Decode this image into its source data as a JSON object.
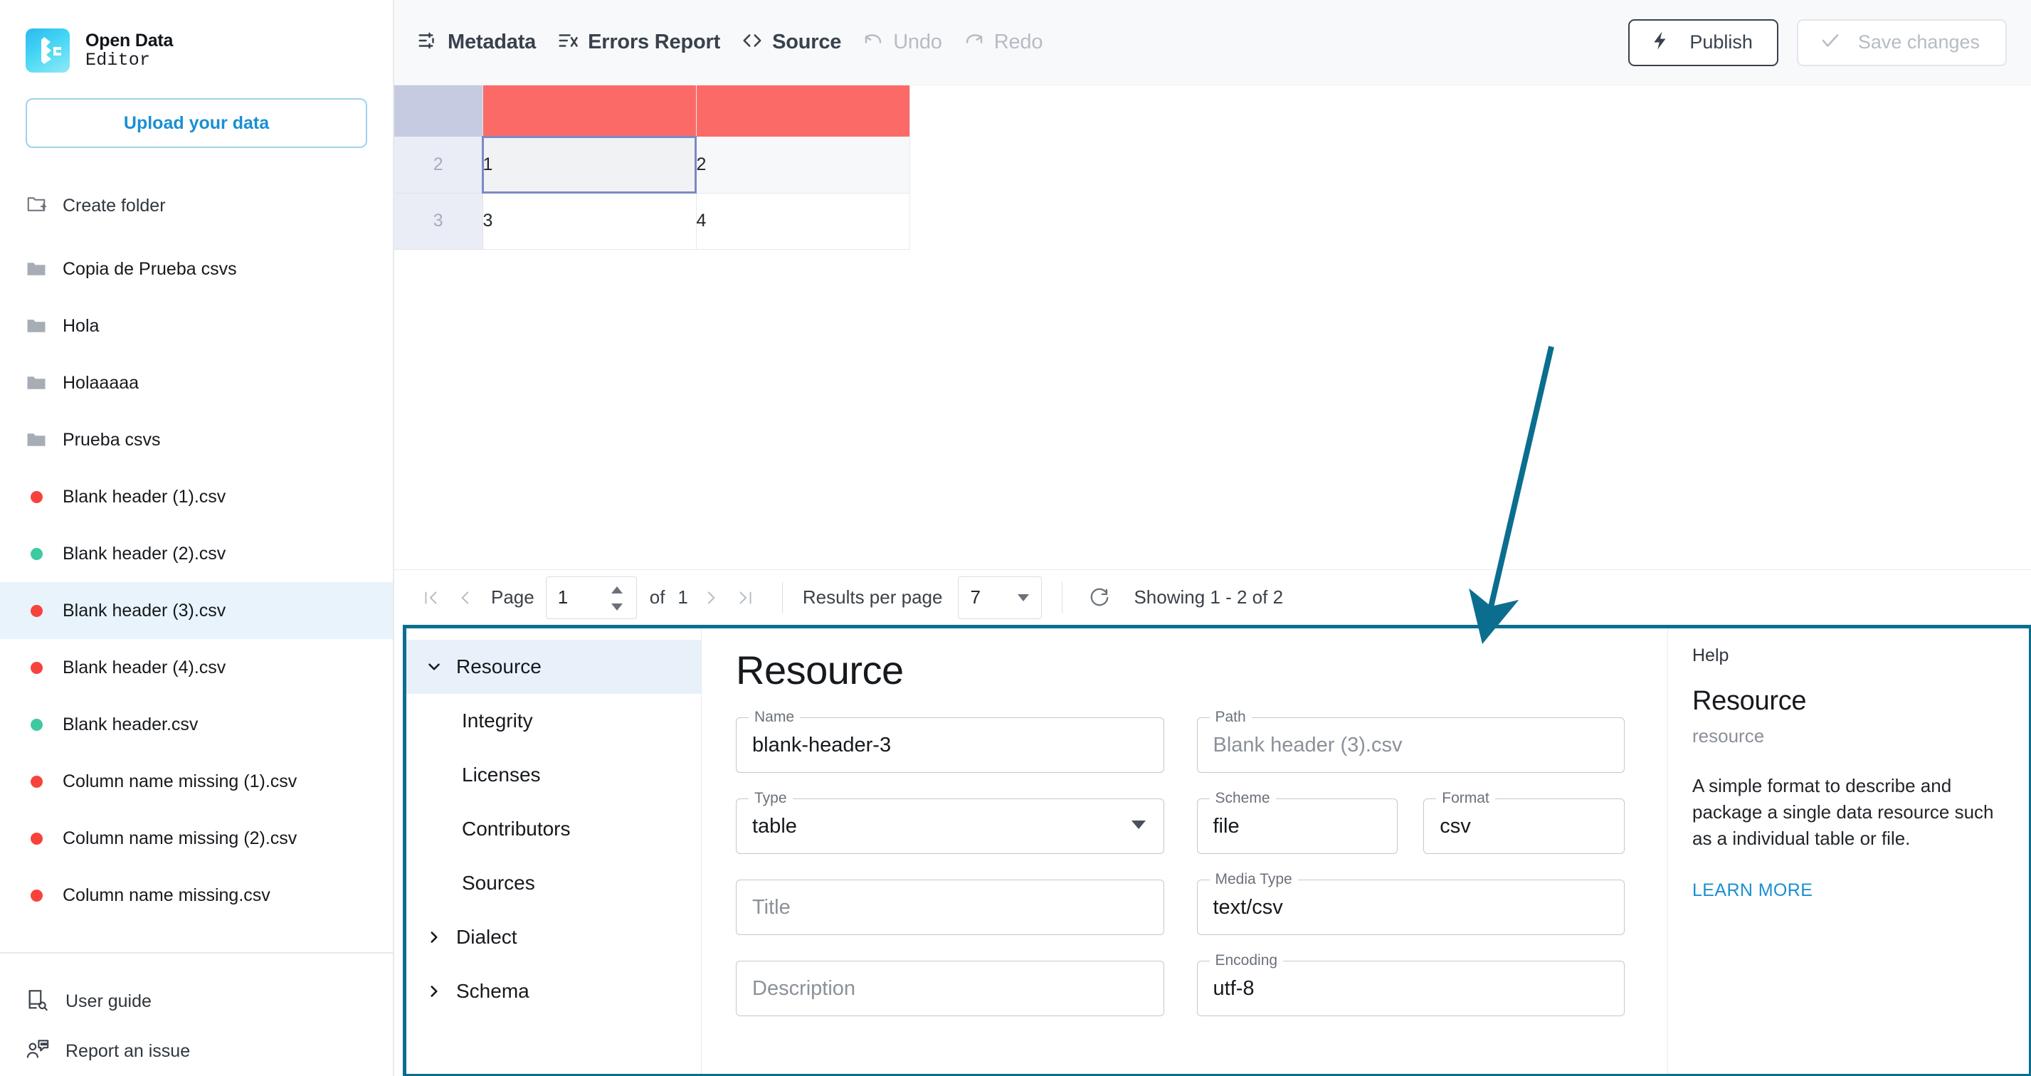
{
  "brand": {
    "line1": "Open Data",
    "line2": "Editor"
  },
  "sidebar": {
    "upload_label": "Upload your data",
    "create_folder_label": "Create folder",
    "folders": [
      {
        "label": "Copia de Prueba csvs"
      },
      {
        "label": "Hola"
      },
      {
        "label": "Holaaaaa"
      },
      {
        "label": "Prueba csvs"
      }
    ],
    "files": [
      {
        "label": "Blank header (1).csv",
        "status": "error",
        "selected": false
      },
      {
        "label": "Blank header (2).csv",
        "status": "ok",
        "selected": false
      },
      {
        "label": "Blank header (3).csv",
        "status": "error",
        "selected": true
      },
      {
        "label": "Blank header (4).csv",
        "status": "error",
        "selected": false
      },
      {
        "label": "Blank header.csv",
        "status": "ok",
        "selected": false
      },
      {
        "label": "Column name missing (1).csv",
        "status": "error",
        "selected": false
      },
      {
        "label": "Column name missing (2).csv",
        "status": "error",
        "selected": false
      },
      {
        "label": "Column name missing.csv",
        "status": "error",
        "selected": false
      }
    ],
    "footer": [
      {
        "label": "User guide"
      },
      {
        "label": "Report an issue"
      }
    ],
    "colors": {
      "error": "#f8423c",
      "ok": "#3ec9a0",
      "selected_bg": "#e8f3fb"
    }
  },
  "toolbar": {
    "metadata_label": "Metadata",
    "errors_report_label": "Errors Report",
    "source_label": "Source",
    "undo_label": "Undo",
    "redo_label": "Redo",
    "publish_label": "Publish",
    "save_label": "Save changes"
  },
  "grid": {
    "header_cells": [
      "",
      ""
    ],
    "rows": [
      {
        "index": "2",
        "cells": [
          "1",
          "2"
        ],
        "active_cell": 0
      },
      {
        "index": "3",
        "cells": [
          "3",
          "4"
        ],
        "active_cell": -1
      }
    ],
    "header_error_color": "#fb6a66",
    "index_header_color": "#c5cbe0"
  },
  "pagination": {
    "page_label": "Page",
    "page_value": "1",
    "of_label": "of",
    "total_pages": "1",
    "results_per_page_label": "Results per page",
    "results_per_page_value": "7",
    "showing_label": "Showing 1 - 2 of 2"
  },
  "metadata": {
    "nav": [
      {
        "label": "Resource",
        "level": 0,
        "expanded": true,
        "active": true
      },
      {
        "label": "Integrity",
        "level": 1,
        "expanded": null,
        "active": false
      },
      {
        "label": "Licenses",
        "level": 1,
        "expanded": null,
        "active": false
      },
      {
        "label": "Contributors",
        "level": 1,
        "expanded": null,
        "active": false
      },
      {
        "label": "Sources",
        "level": 1,
        "expanded": null,
        "active": false
      },
      {
        "label": "Dialect",
        "level": 0,
        "expanded": false,
        "active": false
      },
      {
        "label": "Schema",
        "level": 0,
        "expanded": false,
        "active": false
      }
    ],
    "form": {
      "title": "Resource",
      "name": {
        "legend": "Name",
        "value": "blank-header-3",
        "placeholder": ""
      },
      "path": {
        "legend": "Path",
        "value": "",
        "placeholder": "Blank header (3).csv"
      },
      "type": {
        "legend": "Type",
        "value": "table",
        "placeholder": ""
      },
      "scheme": {
        "legend": "Scheme",
        "value": "file",
        "placeholder": ""
      },
      "format": {
        "legend": "Format",
        "value": "csv",
        "placeholder": ""
      },
      "title_field": {
        "legend": "",
        "value": "",
        "placeholder": "Title"
      },
      "media_type": {
        "legend": "Media Type",
        "value": "text/csv",
        "placeholder": ""
      },
      "description": {
        "legend": "",
        "value": "",
        "placeholder": "Description"
      },
      "encoding": {
        "legend": "Encoding",
        "value": "utf-8",
        "placeholder": ""
      }
    },
    "help": {
      "kicker": "Help",
      "title": "Resource",
      "subtitle": "resource",
      "body": "A simple format to describe and package a single data resource such as a individual table or file.",
      "link": "LEARN MORE"
    },
    "border_color": "#0b6e8f"
  },
  "annotation": {
    "arrow_color": "#0b6e8f"
  }
}
